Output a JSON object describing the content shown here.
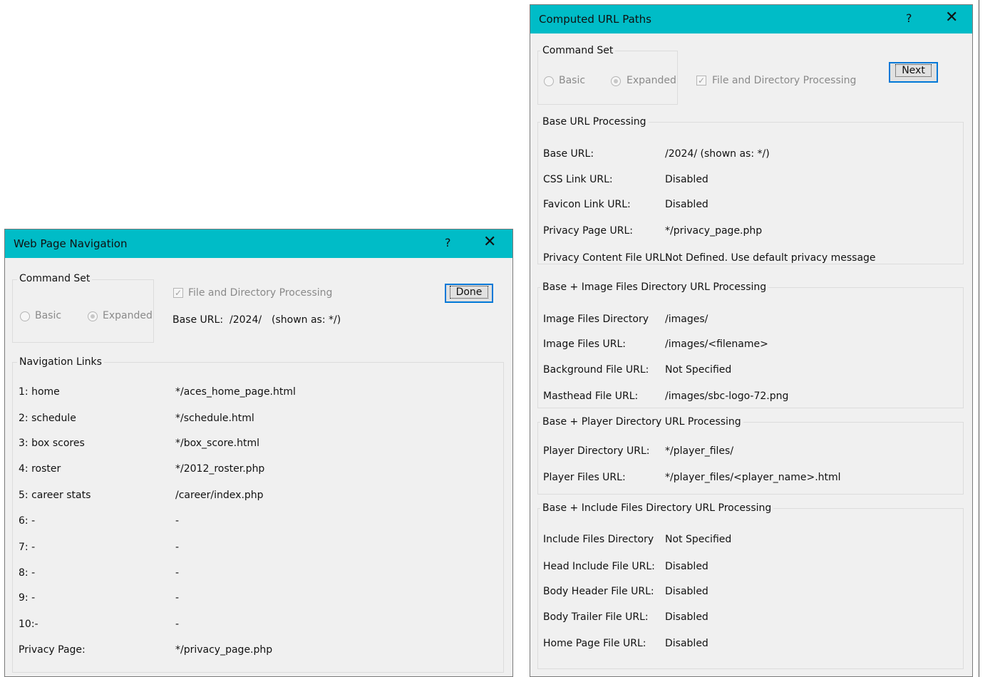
{
  "nav_dialog": {
    "title": "Web Page Navigation",
    "help": "?",
    "close": "✕",
    "command_set": {
      "label": "Command Set",
      "basic": "Basic",
      "expanded": "Expanded"
    },
    "file_dir_processing": "File and Directory Processing",
    "base_url_label": "Base URL:",
    "base_url_value": "/2024/",
    "base_url_shown": "(shown as: */)",
    "done_button": "Done",
    "nav_links": {
      "label": "Navigation Links",
      "rows": [
        {
          "name": "1:  home",
          "url": "*/aces_home_page.html"
        },
        {
          "name": "2:  schedule",
          "url": "*/schedule.html"
        },
        {
          "name": "3:  box scores",
          "url": "*/box_score.html"
        },
        {
          "name": "4:  roster",
          "url": "*/2012_roster.php"
        },
        {
          "name": "5:  career stats",
          "url": "/career/index.php"
        },
        {
          "name": "6:  -",
          "url": "-"
        },
        {
          "name": "7:  -",
          "url": "-"
        },
        {
          "name": "8:  -",
          "url": "-"
        },
        {
          "name": "9:  -",
          "url": "-"
        },
        {
          "name": "10:-",
          "url": "-"
        },
        {
          "name": "Privacy Page:",
          "url": "*/privacy_page.php"
        }
      ]
    }
  },
  "url_dialog": {
    "title": "Computed URL Paths",
    "help": "?",
    "close": "✕",
    "command_set": {
      "label": "Command Set",
      "basic": "Basic",
      "expanded": "Expanded"
    },
    "file_dir_processing": "File and Directory Processing",
    "next_button": "Next",
    "base_group": {
      "label": "Base URL Processing",
      "rows": [
        {
          "key": "Base URL:",
          "value": "/2024/    (shown as: */)"
        },
        {
          "key": "CSS Link URL:",
          "value": "Disabled"
        },
        {
          "key": "Favicon Link URL:",
          "value": "Disabled"
        },
        {
          "key": "Privacy Page URL:",
          "value": "*/privacy_page.php"
        },
        {
          "key": "Privacy Content File URL:",
          "value": "Not Defined. Use default privacy message"
        }
      ]
    },
    "image_group": {
      "label": "Base + Image Files Directory URL Processing",
      "rows": [
        {
          "key": "Image Files Directory",
          "value": "/images/"
        },
        {
          "key": "Image Files URL:",
          "value": "/images/<filename>"
        },
        {
          "key": "Background File URL:",
          "value": "Not Specified"
        },
        {
          "key": "Masthead File URL:",
          "value": "/images/sbc-logo-72.png"
        }
      ]
    },
    "player_group": {
      "label": "Base + Player Directory URL Processing",
      "rows": [
        {
          "key": "Player Directory URL:",
          "value": "*/player_files/"
        },
        {
          "key": "Player Files URL:",
          "value": "*/player_files/<player_name>.html"
        }
      ]
    },
    "include_group": {
      "label": "Base + Include Files Directory URL Processing",
      "rows": [
        {
          "key": "Include Files Directory",
          "value": "Not Specified"
        },
        {
          "key": "Head Include File URL:",
          "value": "Disabled"
        },
        {
          "key": "Body Header File URL:",
          "value": "Disabled"
        },
        {
          "key": "Body Trailer File URL:",
          "value": "Disabled"
        },
        {
          "key": "Home Page File URL:",
          "value": "Disabled"
        }
      ]
    }
  }
}
